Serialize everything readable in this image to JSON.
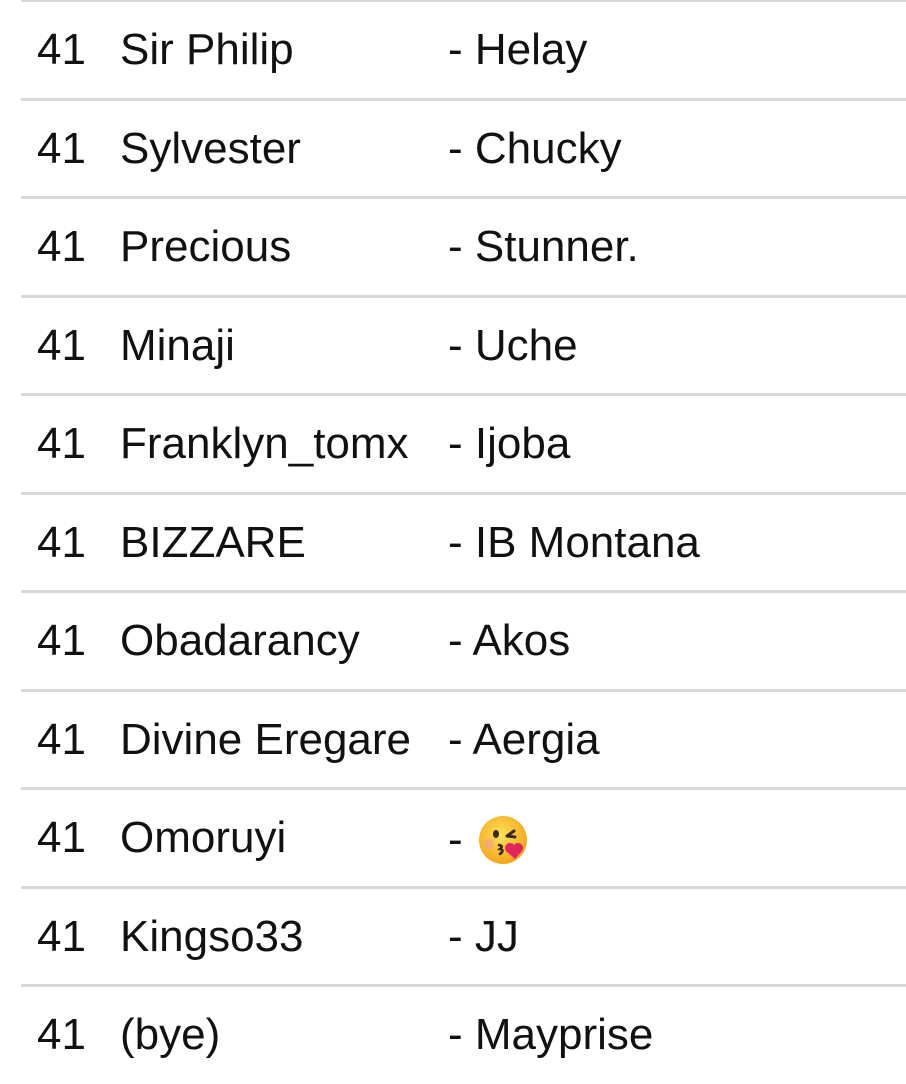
{
  "rows": [
    {
      "num": "41",
      "name": "Sir Philip",
      "value": "- Helay"
    },
    {
      "num": "41",
      "name": "Sylvester",
      "value": "- Chucky"
    },
    {
      "num": "41",
      "name": "Precious",
      "value": "- Stunner."
    },
    {
      "num": "41",
      "name": "Minaji",
      "value": "- Uche"
    },
    {
      "num": "41",
      "name": "Franklyn_tomx",
      "value": "- Ijoba"
    },
    {
      "num": "41",
      "name": "BIZZARE",
      "value": "- IB Montana"
    },
    {
      "num": "41",
      "name": "Obadarancy",
      "value": "- Akos"
    },
    {
      "num": "41",
      "name": "Divine Eregare",
      "value": "- Aergia"
    },
    {
      "num": "41",
      "name": "Omoruyi",
      "value": "-",
      "icon": "face-blowing-kiss-emoji"
    },
    {
      "num": "41",
      "name": "Kingso33",
      "value": "- JJ"
    },
    {
      "num": "41",
      "name": "(bye)",
      "value": "- Mayprise"
    }
  ]
}
